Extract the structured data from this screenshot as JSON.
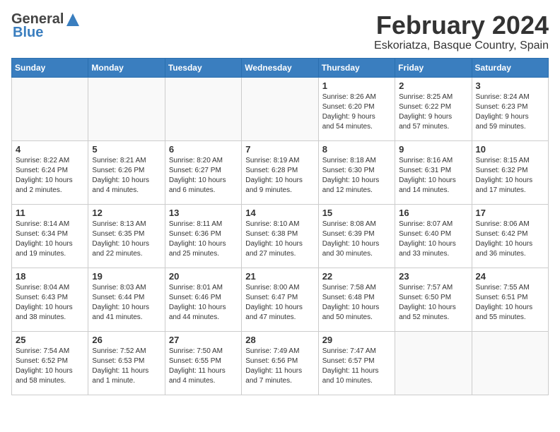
{
  "header": {
    "logo_general": "General",
    "logo_blue": "Blue",
    "month_title": "February 2024",
    "location": "Eskoriatza, Basque Country, Spain"
  },
  "columns": [
    "Sunday",
    "Monday",
    "Tuesday",
    "Wednesday",
    "Thursday",
    "Friday",
    "Saturday"
  ],
  "weeks": [
    [
      {
        "num": "",
        "info": ""
      },
      {
        "num": "",
        "info": ""
      },
      {
        "num": "",
        "info": ""
      },
      {
        "num": "",
        "info": ""
      },
      {
        "num": "1",
        "info": "Sunrise: 8:26 AM\nSunset: 6:20 PM\nDaylight: 9 hours\nand 54 minutes."
      },
      {
        "num": "2",
        "info": "Sunrise: 8:25 AM\nSunset: 6:22 PM\nDaylight: 9 hours\nand 57 minutes."
      },
      {
        "num": "3",
        "info": "Sunrise: 8:24 AM\nSunset: 6:23 PM\nDaylight: 9 hours\nand 59 minutes."
      }
    ],
    [
      {
        "num": "4",
        "info": "Sunrise: 8:22 AM\nSunset: 6:24 PM\nDaylight: 10 hours\nand 2 minutes."
      },
      {
        "num": "5",
        "info": "Sunrise: 8:21 AM\nSunset: 6:26 PM\nDaylight: 10 hours\nand 4 minutes."
      },
      {
        "num": "6",
        "info": "Sunrise: 8:20 AM\nSunset: 6:27 PM\nDaylight: 10 hours\nand 6 minutes."
      },
      {
        "num": "7",
        "info": "Sunrise: 8:19 AM\nSunset: 6:28 PM\nDaylight: 10 hours\nand 9 minutes."
      },
      {
        "num": "8",
        "info": "Sunrise: 8:18 AM\nSunset: 6:30 PM\nDaylight: 10 hours\nand 12 minutes."
      },
      {
        "num": "9",
        "info": "Sunrise: 8:16 AM\nSunset: 6:31 PM\nDaylight: 10 hours\nand 14 minutes."
      },
      {
        "num": "10",
        "info": "Sunrise: 8:15 AM\nSunset: 6:32 PM\nDaylight: 10 hours\nand 17 minutes."
      }
    ],
    [
      {
        "num": "11",
        "info": "Sunrise: 8:14 AM\nSunset: 6:34 PM\nDaylight: 10 hours\nand 19 minutes."
      },
      {
        "num": "12",
        "info": "Sunrise: 8:13 AM\nSunset: 6:35 PM\nDaylight: 10 hours\nand 22 minutes."
      },
      {
        "num": "13",
        "info": "Sunrise: 8:11 AM\nSunset: 6:36 PM\nDaylight: 10 hours\nand 25 minutes."
      },
      {
        "num": "14",
        "info": "Sunrise: 8:10 AM\nSunset: 6:38 PM\nDaylight: 10 hours\nand 27 minutes."
      },
      {
        "num": "15",
        "info": "Sunrise: 8:08 AM\nSunset: 6:39 PM\nDaylight: 10 hours\nand 30 minutes."
      },
      {
        "num": "16",
        "info": "Sunrise: 8:07 AM\nSunset: 6:40 PM\nDaylight: 10 hours\nand 33 minutes."
      },
      {
        "num": "17",
        "info": "Sunrise: 8:06 AM\nSunset: 6:42 PM\nDaylight: 10 hours\nand 36 minutes."
      }
    ],
    [
      {
        "num": "18",
        "info": "Sunrise: 8:04 AM\nSunset: 6:43 PM\nDaylight: 10 hours\nand 38 minutes."
      },
      {
        "num": "19",
        "info": "Sunrise: 8:03 AM\nSunset: 6:44 PM\nDaylight: 10 hours\nand 41 minutes."
      },
      {
        "num": "20",
        "info": "Sunrise: 8:01 AM\nSunset: 6:46 PM\nDaylight: 10 hours\nand 44 minutes."
      },
      {
        "num": "21",
        "info": "Sunrise: 8:00 AM\nSunset: 6:47 PM\nDaylight: 10 hours\nand 47 minutes."
      },
      {
        "num": "22",
        "info": "Sunrise: 7:58 AM\nSunset: 6:48 PM\nDaylight: 10 hours\nand 50 minutes."
      },
      {
        "num": "23",
        "info": "Sunrise: 7:57 AM\nSunset: 6:50 PM\nDaylight: 10 hours\nand 52 minutes."
      },
      {
        "num": "24",
        "info": "Sunrise: 7:55 AM\nSunset: 6:51 PM\nDaylight: 10 hours\nand 55 minutes."
      }
    ],
    [
      {
        "num": "25",
        "info": "Sunrise: 7:54 AM\nSunset: 6:52 PM\nDaylight: 10 hours\nand 58 minutes."
      },
      {
        "num": "26",
        "info": "Sunrise: 7:52 AM\nSunset: 6:53 PM\nDaylight: 11 hours\nand 1 minute."
      },
      {
        "num": "27",
        "info": "Sunrise: 7:50 AM\nSunset: 6:55 PM\nDaylight: 11 hours\nand 4 minutes."
      },
      {
        "num": "28",
        "info": "Sunrise: 7:49 AM\nSunset: 6:56 PM\nDaylight: 11 hours\nand 7 minutes."
      },
      {
        "num": "29",
        "info": "Sunrise: 7:47 AM\nSunset: 6:57 PM\nDaylight: 11 hours\nand 10 minutes."
      },
      {
        "num": "",
        "info": ""
      },
      {
        "num": "",
        "info": ""
      }
    ]
  ]
}
